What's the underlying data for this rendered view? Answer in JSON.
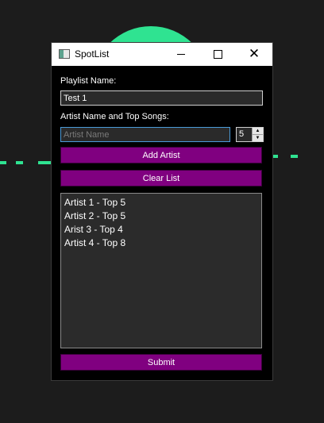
{
  "window": {
    "title": "SpotList"
  },
  "form": {
    "playlist_label": "Playlist Name:",
    "playlist_value": "Test 1",
    "artist_label": "Artist Name and Top Songs:",
    "artist_placeholder": "Artist Name",
    "artist_value": "",
    "top_songs_value": "5",
    "add_artist_label": "Add Artist",
    "clear_list_label": "Clear List",
    "submit_label": "Submit"
  },
  "list": {
    "items": [
      "Artist 1 - Top 5",
      "Artist 2 - Top 5",
      "Arist 3 - Top 4",
      "Artist 4 - Top 8"
    ]
  },
  "colors": {
    "button": "#800080",
    "background_accent": "#2fe391",
    "window_bg": "#000000"
  }
}
